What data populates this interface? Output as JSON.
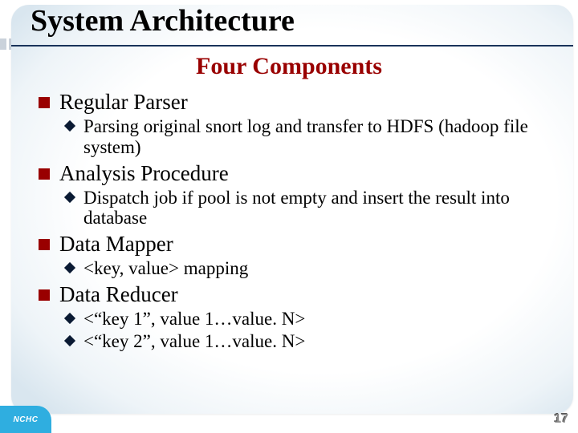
{
  "title": "System Architecture",
  "subtitle": "Four Components",
  "bullets": [
    {
      "label": "Regular Parser",
      "children": [
        "Parsing original snort log and transfer to HDFS (hadoop file system)"
      ]
    },
    {
      "label": "Analysis Procedure",
      "children": [
        "Dispatch job if pool is not empty and  insert the result into database"
      ]
    },
    {
      "label": "Data Mapper",
      "children": [
        "<key, value> mapping"
      ]
    },
    {
      "label": "Data Reducer",
      "children": [
        "<“key 1”, value 1…value. N>",
        "<“key 2”, value 1…value. N>"
      ]
    }
  ],
  "footer": {
    "logo_text": "NCHC",
    "page_number": "17"
  }
}
